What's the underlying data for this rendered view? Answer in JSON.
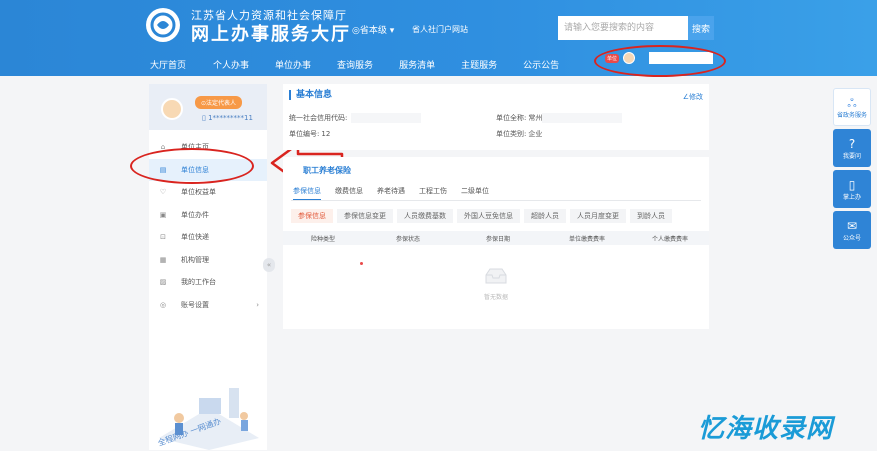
{
  "header": {
    "org_name": "江苏省人力资源和社会保障厅",
    "hall_name": "网上办事服务大厅",
    "region": "◎省本级 ▾",
    "personal_portal": "省人社门户网站",
    "search_placeholder": "请输入您要搜索的内容",
    "search_button": "搜索",
    "nav": [
      "大厅首页",
      "个人办事",
      "单位办事",
      "查询服务",
      "服务清单",
      "主题服务",
      "公示公告"
    ],
    "user_badge": "单位"
  },
  "sidebar": {
    "role_badge": "⊙法定代表人",
    "phone": "1*********11",
    "items": [
      {
        "label": "单位主页",
        "icon": "home-icon",
        "glyph": "⌂"
      },
      {
        "label": "单位信息",
        "icon": "document-icon",
        "glyph": "▤"
      },
      {
        "label": "单位权益单",
        "icon": "shield-icon",
        "glyph": "♡"
      },
      {
        "label": "单位办件",
        "icon": "file-icon",
        "glyph": "▣"
      },
      {
        "label": "单位快递",
        "icon": "express-icon",
        "glyph": "⊡"
      },
      {
        "label": "机构管理",
        "icon": "org-icon",
        "glyph": "▦"
      },
      {
        "label": "我的工作台",
        "icon": "workbench-icon",
        "glyph": "▨"
      },
      {
        "label": "账号设置",
        "icon": "settings-icon",
        "glyph": "◎"
      }
    ],
    "collapse": "«"
  },
  "basic_info": {
    "title": "基本信息",
    "edit": "∠修改",
    "credit_code_label": "统一社会信用代码:",
    "full_name_label": "单位全称:",
    "full_name_value": "常州",
    "unit_no_label": "单位编号:",
    "unit_no_value": "12",
    "unit_type_label": "单位类别:",
    "unit_type_value": "企业"
  },
  "pension": {
    "title": "职工养老保险",
    "tabs": [
      "参保信息",
      "缴费信息",
      "养老待遇",
      "工程工伤",
      "二级单位"
    ],
    "subtabs": [
      "参保信息",
      "参保信息变更",
      "人员缴费基数",
      "外国人豆免信息",
      "超龄人员",
      "人员月度变更",
      "到龄人员"
    ],
    "columns": [
      "险种类型",
      "参保状态",
      "参保日期",
      "单位缴费费率",
      "个人缴费费率"
    ],
    "empty_text": "暂无数据"
  },
  "float_bar": [
    {
      "label": "省政务服务",
      "icon": "gov-logo-icon",
      "glyph": "ஃ"
    },
    {
      "label": "我要问",
      "icon": "question-icon",
      "glyph": "?"
    },
    {
      "label": "掌上办",
      "icon": "mobile-icon",
      "glyph": "▯"
    },
    {
      "label": "公众号",
      "icon": "wechat-icon",
      "glyph": "✉"
    }
  ],
  "watermark": "忆海收录网",
  "colors": {
    "primary": "#2b86d6",
    "annotation_red": "#d9241f",
    "badge_orange": "#f79947"
  }
}
